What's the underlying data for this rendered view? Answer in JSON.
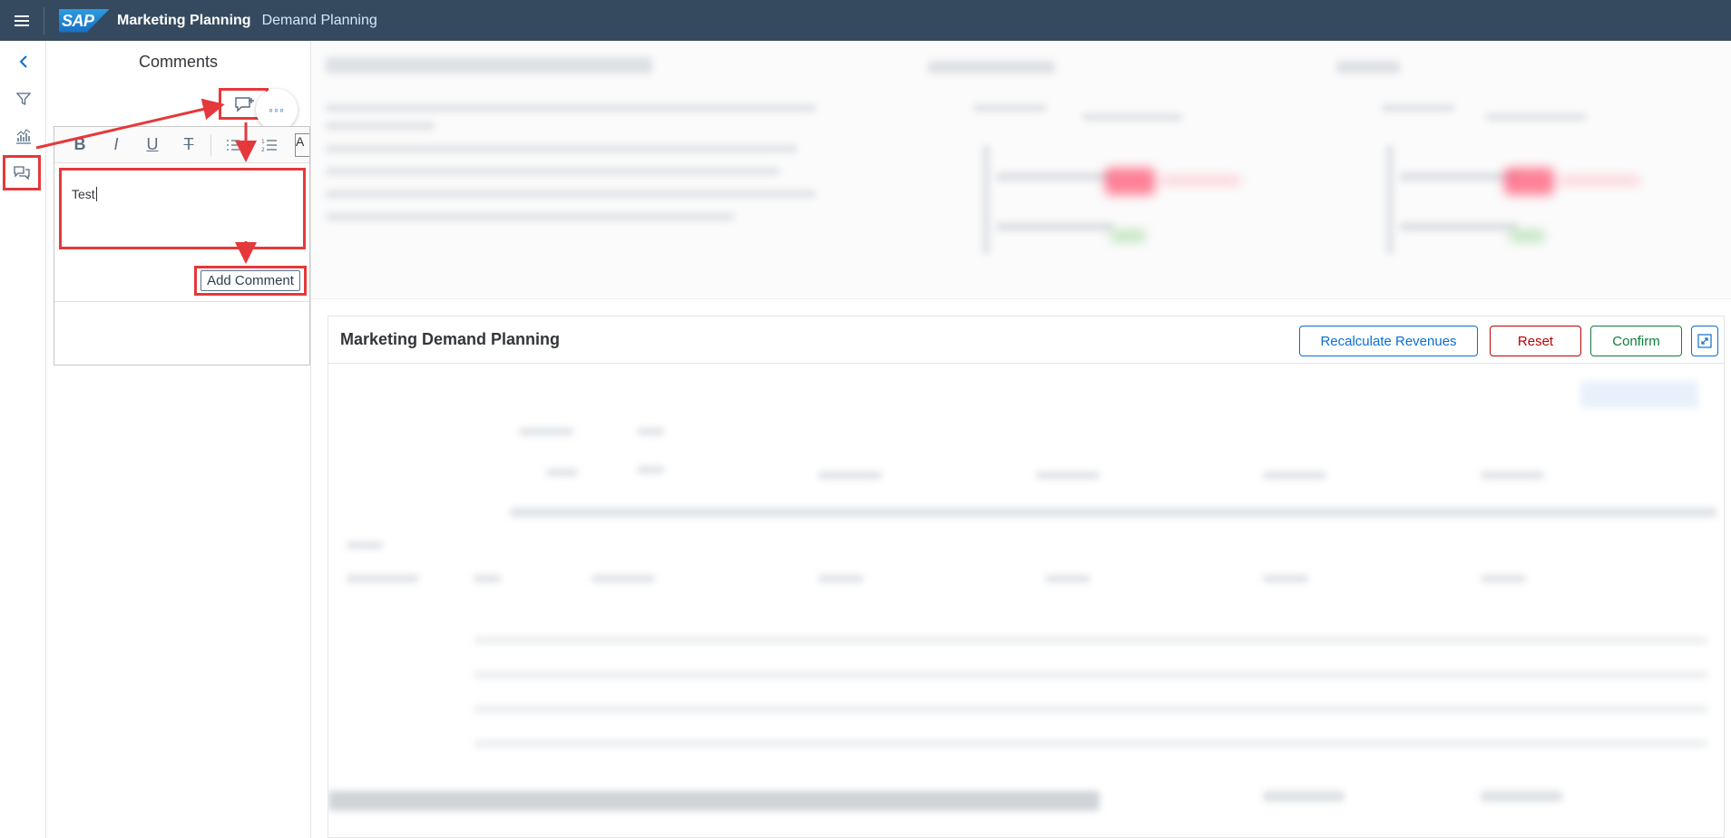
{
  "shell": {
    "logo_text": "SAP",
    "app_title": "Marketing Planning",
    "app_subtitle": "Demand Planning"
  },
  "side_nav": {
    "items": [
      {
        "icon": "chevron-left-icon"
      },
      {
        "icon": "filter-icon"
      },
      {
        "icon": "chart-icon"
      },
      {
        "icon": "comments-icon"
      }
    ]
  },
  "comments_panel": {
    "title": "Comments",
    "new_comment_icon": "comment-add-icon",
    "more_label": "◦◦◦",
    "toolbar": {
      "bold": "B",
      "italic": "I",
      "underline": "U",
      "strike": "T",
      "color_label": "A"
    },
    "editor_value": "Test",
    "add_comment_label": "Add Comment"
  },
  "table_card": {
    "title": "Marketing Demand Planning",
    "buttons": {
      "recalculate": "Recalculate Revenues",
      "reset": "Reset",
      "confirm": "Confirm"
    },
    "fullscreen_icon": "fullscreen-icon"
  },
  "colors": {
    "shell_bg": "#354a5f",
    "annotation_red": "#e5383b",
    "accent_blue": "#0a6ed1",
    "reject_red": "#bb0000",
    "accept_green": "#107e3e"
  }
}
